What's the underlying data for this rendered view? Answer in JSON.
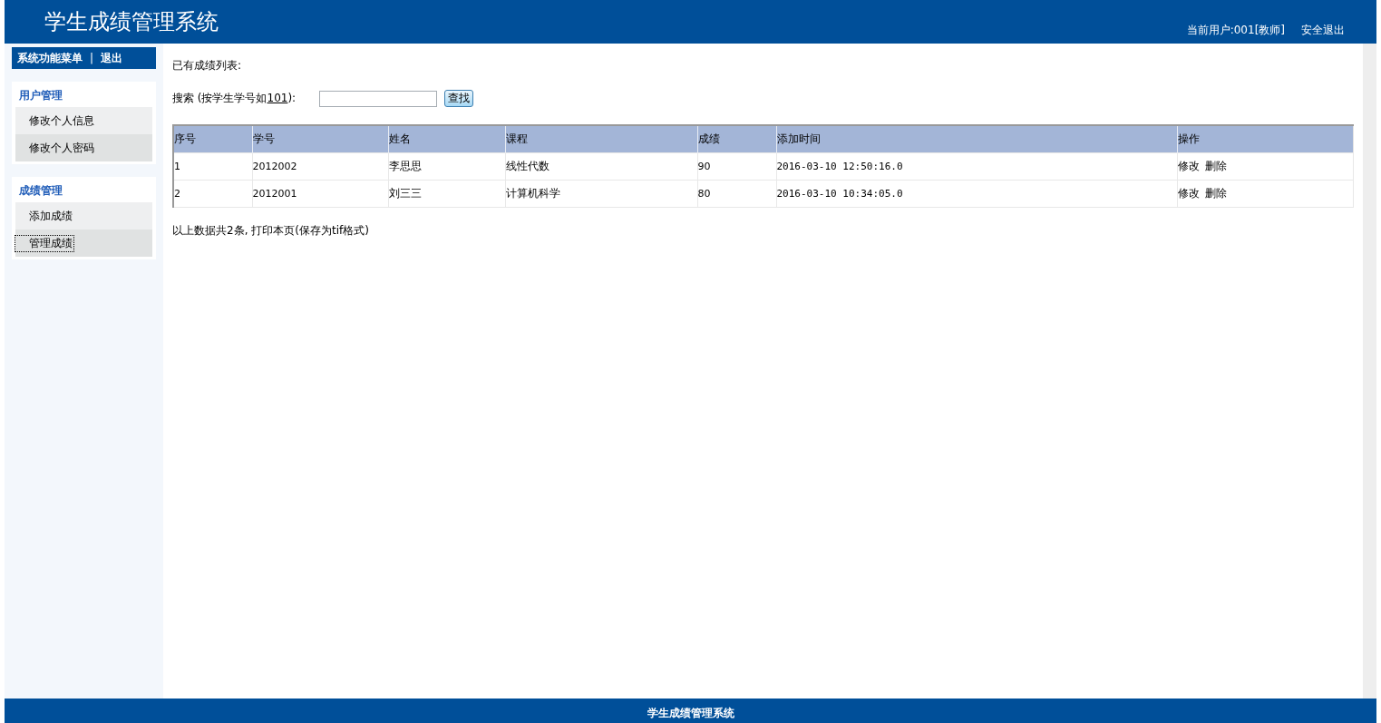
{
  "header": {
    "title": "学生成绩管理系统",
    "current_user": "当前用户:001[教师]",
    "logout": "安全退出"
  },
  "sidebar": {
    "menu_title": "系统功能菜单",
    "separator": "|",
    "exit": "退出",
    "sections": [
      {
        "title": "用户管理",
        "items": [
          {
            "label": "修改个人信息",
            "selected": false
          },
          {
            "label": "修改个人密码",
            "selected": false
          }
        ]
      },
      {
        "title": "成绩管理",
        "items": [
          {
            "label": "添加成绩",
            "selected": false
          },
          {
            "label": "管理成绩",
            "selected": true
          }
        ]
      }
    ]
  },
  "content": {
    "heading": "已有成绩列表:",
    "search": {
      "label_prefix": "搜索 (按学生学号如",
      "example": "101",
      "label_suffix": "):",
      "button": "查找"
    },
    "table": {
      "columns": [
        "序号",
        "学号",
        "姓名",
        "课程",
        "成绩",
        "添加时间",
        "操作"
      ],
      "rows": [
        {
          "cells": [
            "1",
            "2012002",
            "李思思",
            "线性代数",
            "90",
            "2016-03-10 12:50:16.0"
          ],
          "actions": [
            "修改",
            "删除"
          ]
        },
        {
          "cells": [
            "2",
            "2012001",
            "刘三三",
            "计算机科学",
            "80",
            "2016-03-10 10:34:05.0"
          ],
          "actions": [
            "修改",
            "删除"
          ]
        }
      ]
    },
    "summary": "以上数据共2条, 打印本页(保存为tif格式)"
  },
  "footer": {
    "text": "学生成绩管理系统"
  }
}
